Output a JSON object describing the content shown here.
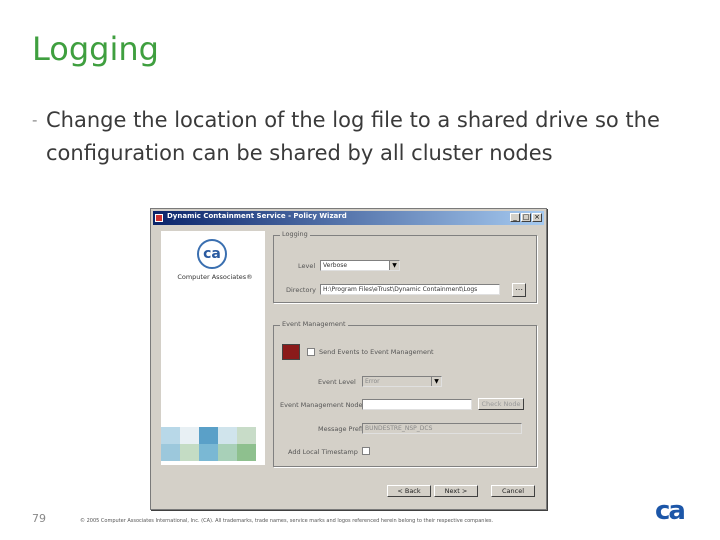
{
  "slide": {
    "title": "Logging",
    "bullet_marker": "-",
    "bullet_text": "Change the location of the log file to a shared drive so the configuration can be shared by all cluster nodes",
    "page_number": "79",
    "footer": "© 2005 Computer Associates International, Inc. (CA). All trademarks, trade names, service marks and logos referenced herein belong to their respective companies.",
    "brand_logo_text": "ca",
    "accent_color": "#3f9f3f",
    "brand_color": "#1c56a8"
  },
  "window": {
    "title": "Dynamic Containment Service - Policy Wizard",
    "minimize": "_",
    "maximize": "□",
    "close": "×",
    "logo_mark": "ca",
    "logo_caption": "Computer Associates®",
    "logging": {
      "group_label": "Logging",
      "level_label": "Level",
      "level_value": "Verbose",
      "directory_label": "Directory",
      "directory_value": "H:\\Program Files\\eTrust\\Dynamic Containment\\Logs",
      "browse_icon": "folder-browse-icon"
    },
    "event_management": {
      "group_label": "Event Management",
      "send_label": "Send Events to Event Management",
      "event_level_label": "Event Level",
      "event_level_value": "Error",
      "node_label": "Event Management Node",
      "node_value": "",
      "check_button": "Check Node",
      "message_prefix_label": "Message Prefix",
      "message_prefix_value": "BUNDESTRE_NSP_DCS",
      "add_local_label": "Add Local Timestamp"
    },
    "buttons": {
      "back": "< Back",
      "next": "Next >",
      "cancel": "Cancel"
    }
  }
}
